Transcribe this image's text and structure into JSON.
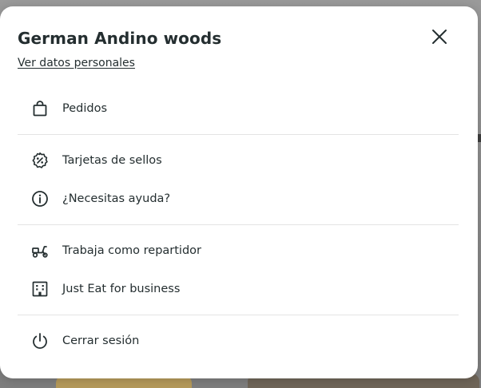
{
  "modal": {
    "title": "German Andino woods",
    "profile_link": "Ver datos personales",
    "close_icon": "close-icon"
  },
  "menu": {
    "items": [
      {
        "label": "Pedidos",
        "icon": "shopping-bag-icon"
      },
      {
        "label": "Tarjetas de sellos",
        "icon": "percent-badge-icon"
      },
      {
        "label": "¿Necesitas ayuda?",
        "icon": "info-icon"
      },
      {
        "label": "Trabaja como repartidor",
        "icon": "scooter-icon"
      },
      {
        "label": "Just Eat for business",
        "icon": "building-icon"
      },
      {
        "label": "Cerrar sesión",
        "icon": "power-icon"
      }
    ]
  },
  "colors": {
    "text": "#242e30",
    "divider": "#e4e4e4",
    "modal_bg": "#ffffff",
    "backdrop": "#8a8a8a"
  }
}
